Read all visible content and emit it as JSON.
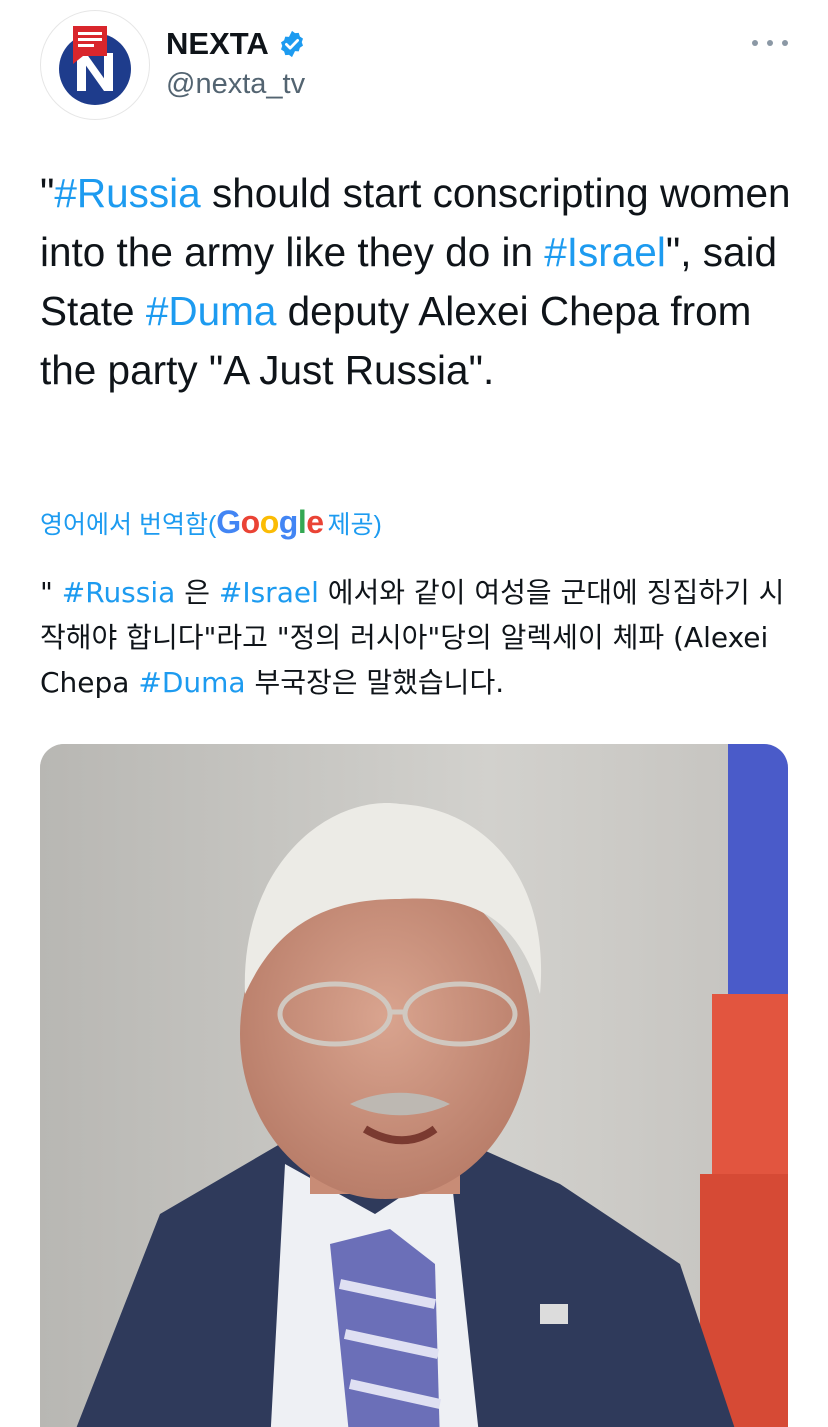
{
  "header": {
    "display_name": "NEXTA",
    "handle": "@nexta_tv",
    "verified_icon": "verified-badge-icon",
    "more_icon": "more-options-icon"
  },
  "tweet": {
    "segments": [
      {
        "text": "\"",
        "hashtag": false
      },
      {
        "text": "#Russia",
        "hashtag": true
      },
      {
        "text": " should start conscripting women into the army like they do in ",
        "hashtag": false
      },
      {
        "text": "#Israel",
        "hashtag": true
      },
      {
        "text": "\", said State ",
        "hashtag": false
      },
      {
        "text": "#Duma",
        "hashtag": true
      },
      {
        "text": " deputy Alexei Chepa from the party \"A Just Russia\".",
        "hashtag": false
      }
    ]
  },
  "translation": {
    "label": "영어에서 번역함(",
    "provider": "Google",
    "suffix": " 제공)",
    "segments": [
      {
        "text": "\" ",
        "hashtag": false
      },
      {
        "text": "#Russia",
        "hashtag": true
      },
      {
        "text": " 은 ",
        "hashtag": false
      },
      {
        "text": "#Israel",
        "hashtag": true
      },
      {
        "text": " 에서와 같이 여성을 군대에 징집하기 시작해야 합니다\"라고 \"정의 러시아\"당의 알렉세이 체파 (Alexei Chepa ",
        "hashtag": false
      },
      {
        "text": "#Duma",
        "hashtag": true
      },
      {
        "text": " 부국장은 말했습니다.",
        "hashtag": false
      }
    ]
  },
  "colors": {
    "accent": "#1d9bf0",
    "text": "#0f1419",
    "secondary": "#536471",
    "nexta_red": "#d9262c",
    "nexta_blue": "#1e3c8c"
  }
}
